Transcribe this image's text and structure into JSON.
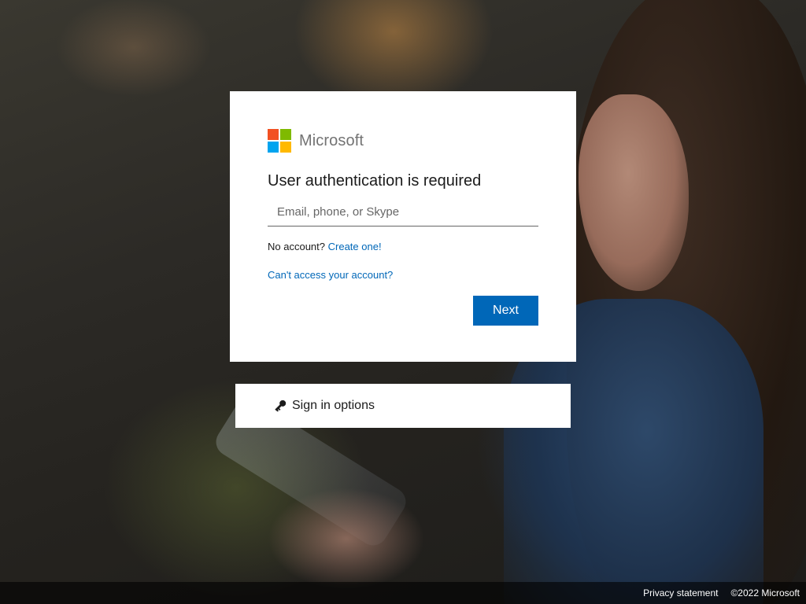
{
  "brand": {
    "name": "Microsoft",
    "logo_colors": [
      "#f25022",
      "#7fba00",
      "#00a4ef",
      "#ffb900"
    ]
  },
  "signin": {
    "title": "User authentication is required",
    "email_placeholder": "Email, phone, or Skype",
    "email_value": "",
    "no_account_text": "No account?",
    "create_account_link": "Create one!",
    "cant_access_link": "Can't access your account?",
    "next_button": "Next"
  },
  "options": {
    "icon": "key-icon",
    "label": "Sign in options"
  },
  "footer": {
    "privacy_link": "Privacy statement",
    "copyright": "©2022 Microsoft"
  },
  "colors": {
    "accent": "#0067b8",
    "text": "#1b1b1b",
    "brand_text": "#737373"
  }
}
